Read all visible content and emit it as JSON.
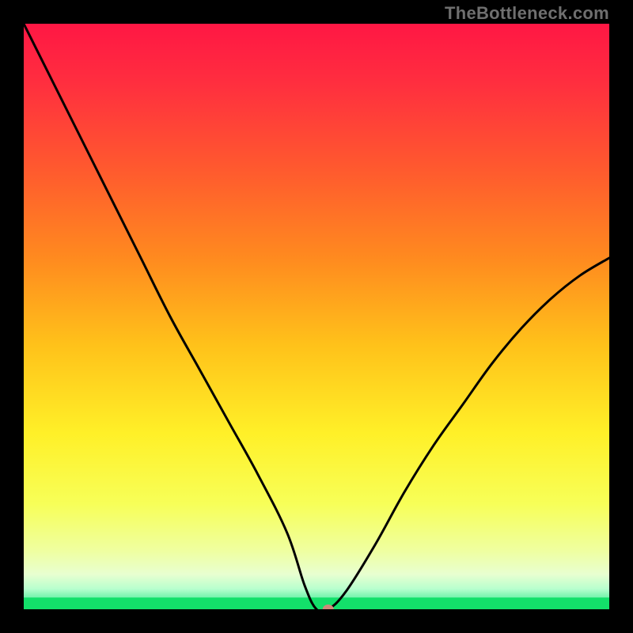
{
  "watermark": "TheBottleneck.com",
  "chart_data": {
    "type": "line",
    "title": "",
    "xlabel": "",
    "ylabel": "",
    "xlim": [
      0,
      100
    ],
    "ylim": [
      0,
      100
    ],
    "x": [
      0,
      5,
      10,
      15,
      20,
      25,
      30,
      35,
      40,
      45,
      48,
      50,
      52,
      55,
      60,
      65,
      70,
      75,
      80,
      85,
      90,
      95,
      100
    ],
    "values": [
      100,
      90,
      80,
      70,
      60,
      50,
      41,
      32,
      23,
      13,
      4,
      0,
      0,
      3,
      11,
      20,
      28,
      35,
      42,
      48,
      53,
      57,
      60
    ],
    "curve_flat_bottom": {
      "x_start": 48,
      "x_end": 52,
      "y": 0
    },
    "marker": {
      "x": 52,
      "y": 0,
      "color": "#cf8a7a"
    },
    "green_band": {
      "y_from": 0,
      "y_to": 2,
      "color": "#13e06a"
    },
    "gradient_stops": [
      {
        "offset": 0.0,
        "color": "#ff1744"
      },
      {
        "offset": 0.1,
        "color": "#ff2e3f"
      },
      {
        "offset": 0.25,
        "color": "#ff5a2e"
      },
      {
        "offset": 0.4,
        "color": "#ff8a1f"
      },
      {
        "offset": 0.55,
        "color": "#ffc21a"
      },
      {
        "offset": 0.7,
        "color": "#fff028"
      },
      {
        "offset": 0.82,
        "color": "#f7ff58"
      },
      {
        "offset": 0.9,
        "color": "#efffa0"
      },
      {
        "offset": 0.94,
        "color": "#e8ffd0"
      },
      {
        "offset": 0.965,
        "color": "#b8ffce"
      },
      {
        "offset": 0.985,
        "color": "#5cf0a0"
      },
      {
        "offset": 1.0,
        "color": "#13e06a"
      }
    ]
  }
}
